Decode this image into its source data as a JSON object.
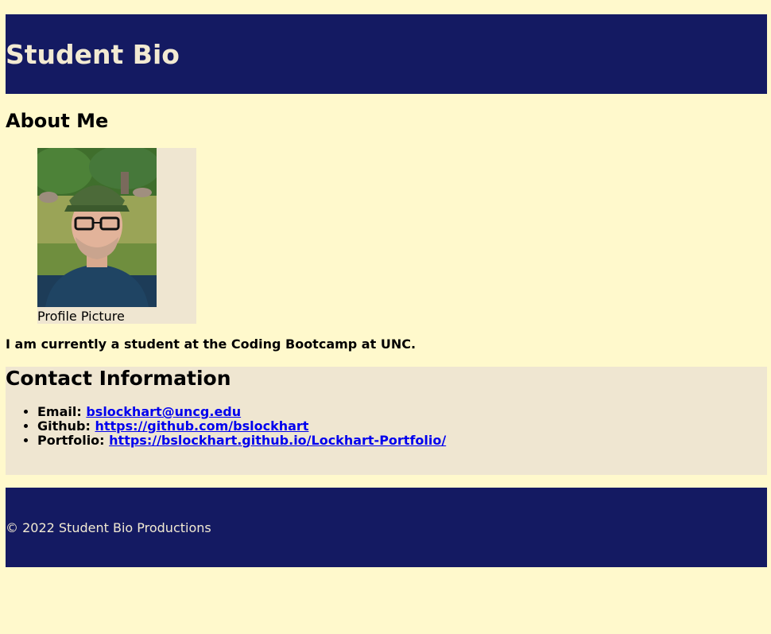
{
  "header": {
    "title": "Student Bio"
  },
  "about": {
    "title": "About Me",
    "figure_caption": "Profile Picture",
    "bio_text": "I am currently a student at the Coding Bootcamp at UNC."
  },
  "contact": {
    "title": "Contact Information",
    "items": [
      {
        "label": "Email:",
        "link": "bslockhart@uncg.edu"
      },
      {
        "label": "Github:",
        "link": "https://github.com/bslockhart"
      },
      {
        "label": "Portfolio:",
        "link": "https://bslockhart.github.io/Lockhart-Portfolio/"
      }
    ]
  },
  "footer": {
    "text": "© 2022 Student Bio Productions"
  },
  "colors": {
    "page_bg": "#fff9cc",
    "header_bg": "#141a62",
    "header_text": "#f2ead2",
    "panel_bg": "#efe6d1",
    "link": "#0000ee"
  }
}
